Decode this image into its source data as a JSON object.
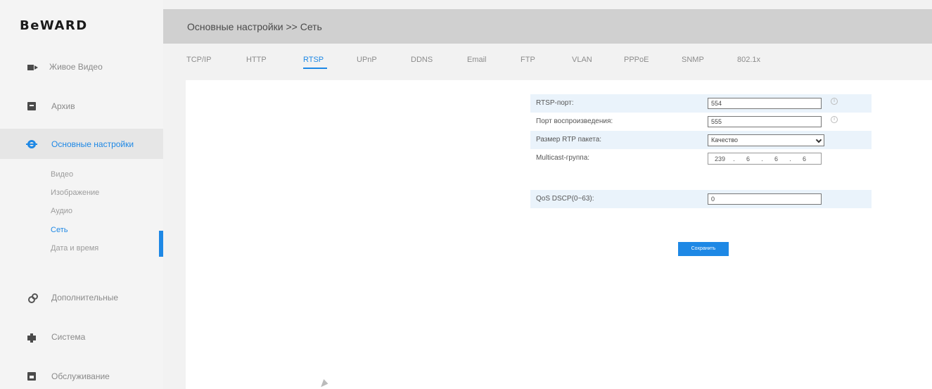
{
  "sidebar": {
    "logo": "BeWARD",
    "items": [
      {
        "label": "Живое Видео",
        "icon": "video-camera-icon"
      },
      {
        "label": "Архив",
        "icon": "archive-icon"
      },
      {
        "label": "Основные настройки",
        "icon": "gear-icon"
      },
      {
        "label": "Дополнительные",
        "icon": "extra-settings-icon"
      },
      {
        "label": "Система",
        "icon": "system-icon"
      },
      {
        "label": "Обслуживание",
        "icon": "maintenance-icon"
      }
    ],
    "subitems": [
      "Видео",
      "Изображение",
      "Аудио",
      "Сеть",
      "Дата и время"
    ]
  },
  "header": {
    "breadcrumb": "Основные настройки >> Сеть"
  },
  "tabs": [
    "TCP/IP",
    "HTTP",
    "RTSP",
    "UPnP",
    "DDNS",
    "Email",
    "FTP",
    "VLAN",
    "PPPoE",
    "SNMP",
    "802.1x"
  ],
  "form": {
    "rtsp_port_label": "RTSP-порт:",
    "rtsp_port_value": "554",
    "playback_port_label": "Порт воспроизведения:",
    "playback_port_value": "555",
    "rtp_size_label": "Размер RTP пакета:",
    "rtp_size_value": "Качество",
    "multicast_label": "Multicast-группа:",
    "multicast_octets": [
      "239",
      "6",
      "6",
      "6"
    ],
    "qos_label": "QoS DSCP(0~63):",
    "qos_value": "0",
    "info_symbol": "i"
  },
  "save_label": "Сохранить",
  "colors": {
    "accent": "#1e88e5",
    "header_bg": "#d0d0d0",
    "row_shade": "#eaf3fb"
  }
}
